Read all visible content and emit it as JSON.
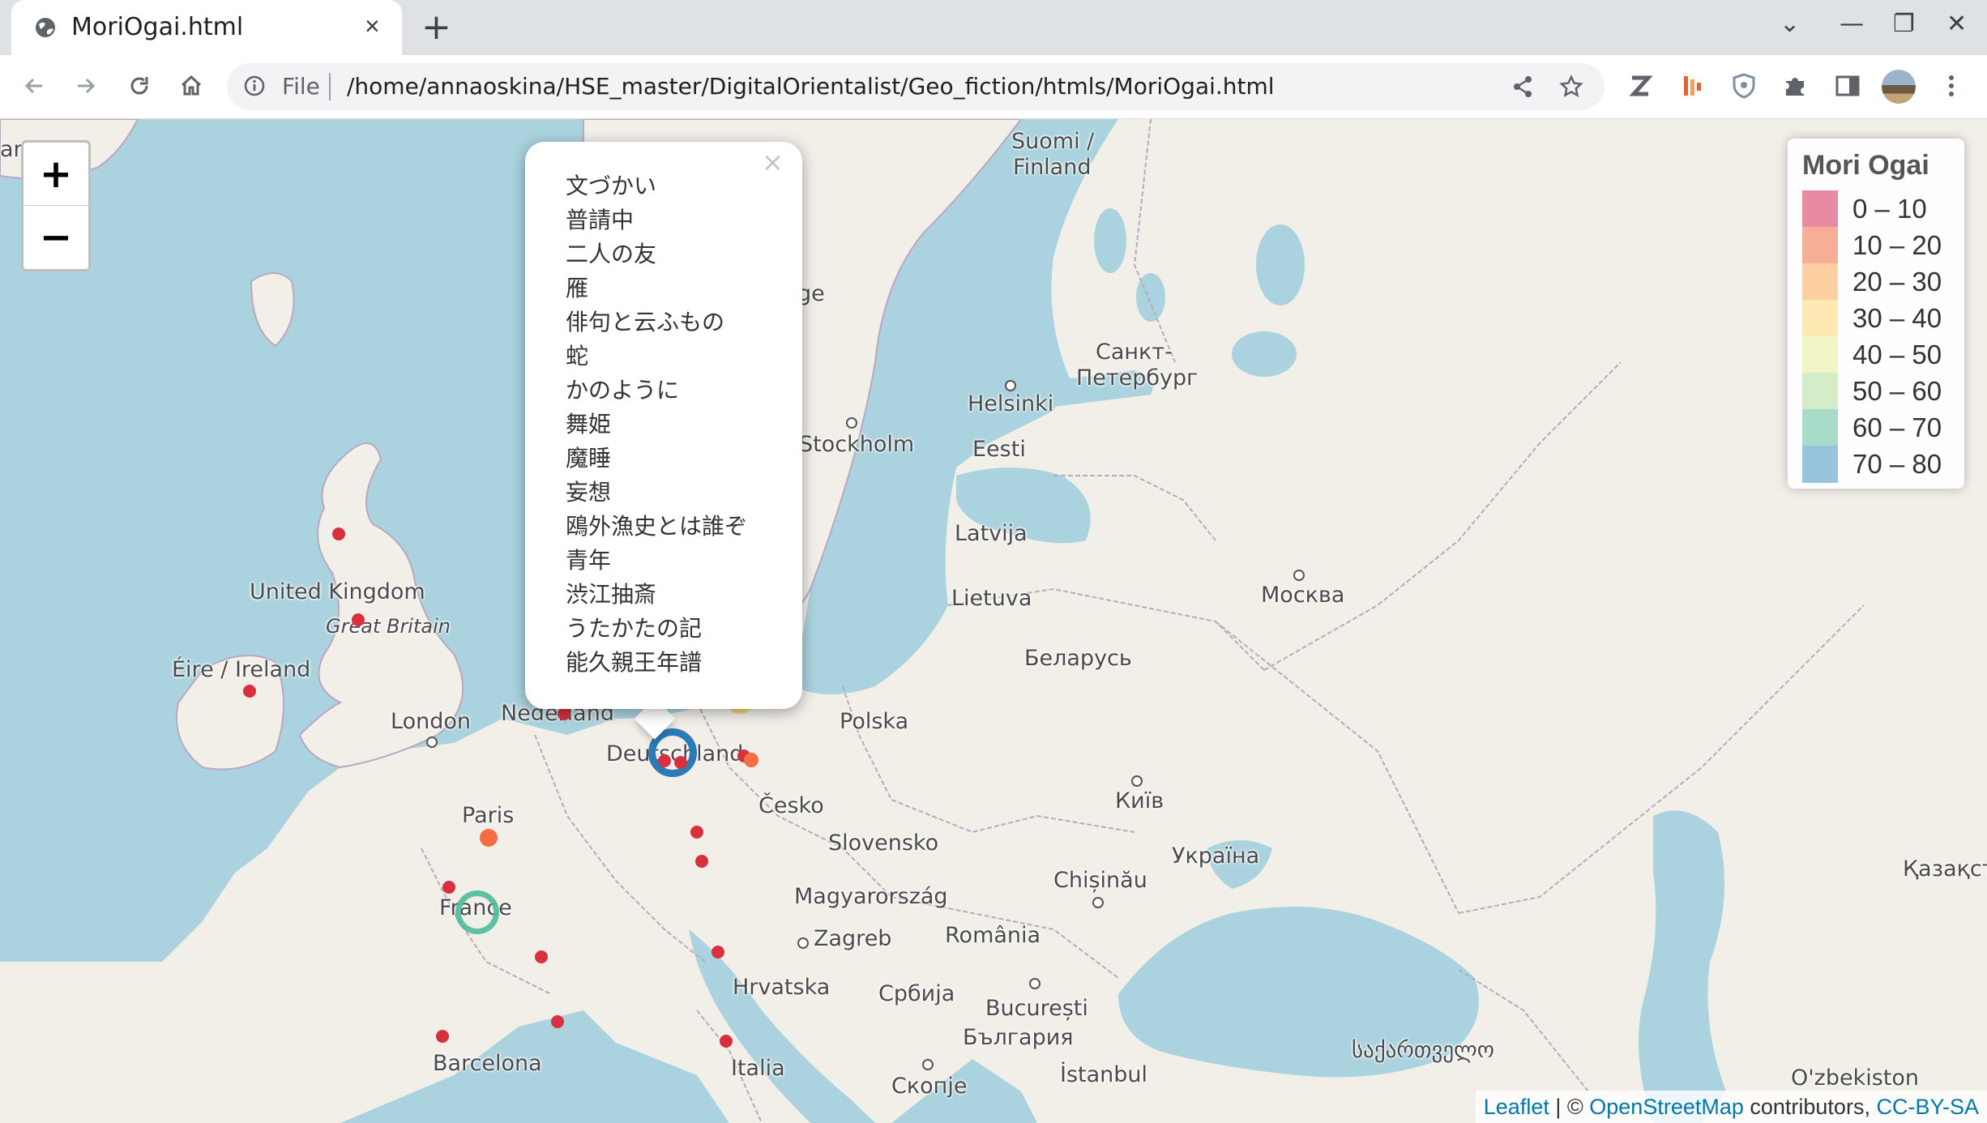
{
  "tab": {
    "title": "MoriOgai.html",
    "close_glyph": "×",
    "favicon": "globe-icon"
  },
  "newtab_glyph": "+",
  "window_controls": {
    "dropdown": "⌄",
    "minimize": "—",
    "restore": "❐",
    "close": "✕"
  },
  "toolbar": {
    "scheme": "File",
    "url": "/home/annaoskina/HSE_master/DigitalOrientalist/Geo_fiction/htmls/MoriOgai.html",
    "icons": [
      "back-icon",
      "forward-icon",
      "reload-icon",
      "home-icon",
      "info-icon",
      "share-icon",
      "star-icon",
      "extension-z-icon",
      "extension-bar-icon",
      "extension-shield-icon",
      "puzzle-icon",
      "sidepanel-icon",
      "avatar",
      "menu-icon"
    ]
  },
  "map": {
    "zoom_in": "+",
    "zoom_out": "−",
    "labels": {
      "suomi": "Suomi /",
      "finland": "Finland",
      "sankt": "Санкт-",
      "peterburg": "Петербург",
      "helsinki": "Helsinki",
      "stockholm": "Stockholm",
      "eesti": "Eesti",
      "latvija": "Latvija",
      "lietuva": "Lietuva",
      "moskva": "Москва",
      "belarus": "Беларусь",
      "polska": "Polska",
      "uk": "United Kingdom",
      "gb": "Great Britain",
      "ireland": "Éire / Ireland",
      "london": "London",
      "nederland": "Nederland",
      "deutschland": "Deutschland",
      "cesko": "Česko",
      "slovensko": "Slovensko",
      "kyiv": "Київ",
      "ukraina": "Україна",
      "chisinau": "Chișinău",
      "paris": "Paris",
      "france": "France",
      "magyar": "Magyarország",
      "zagreb": "Zagreb",
      "romania": "România",
      "kazakh": "Қазақст",
      "hrvatska": "Hrvatska",
      "srbija": "Србија",
      "bucuresti": "București",
      "bulgaria": "България",
      "barcelona": "Barcelona",
      "italia": "Italia",
      "skopje": "Скопје",
      "istanbul": "İstanbul",
      "georgia": "საქართველო",
      "ozbekiston": "O'zbekiston",
      "norge": "ge",
      "left_edge": "an"
    },
    "legend": {
      "title": "Mori Ogai",
      "items": [
        {
          "label": "0 – 10",
          "color": "#e78aa2"
        },
        {
          "label": "10 – 20",
          "color": "#f7ae96"
        },
        {
          "label": "20 – 30",
          "color": "#fdd0a2"
        },
        {
          "label": "30 – 40",
          "color": "#fee9b5"
        },
        {
          "label": "40 – 50",
          "color": "#f2f5c6"
        },
        {
          "label": "50 – 60",
          "color": "#d4edc8"
        },
        {
          "label": "60 – 70",
          "color": "#a8dcc8"
        },
        {
          "label": "70 – 80",
          "color": "#99c4df"
        }
      ]
    },
    "popup": {
      "close": "×",
      "items": [
        "文づかい",
        "普請中",
        "二人の友",
        "雁",
        "俳句と云ふもの",
        "蛇",
        "かのように",
        "舞姫",
        "魔睡",
        "妄想",
        "鴎外漁史とは誰ぞ",
        "青年",
        "渋江抽斎",
        "うたかたの記",
        "能久親王年譜"
      ]
    },
    "attribution": {
      "leaflet": "Leaflet",
      "sep": " | © ",
      "osm": "OpenStreetMap",
      "contrib": " contributors, ",
      "license": "CC-BY-SA"
    }
  }
}
